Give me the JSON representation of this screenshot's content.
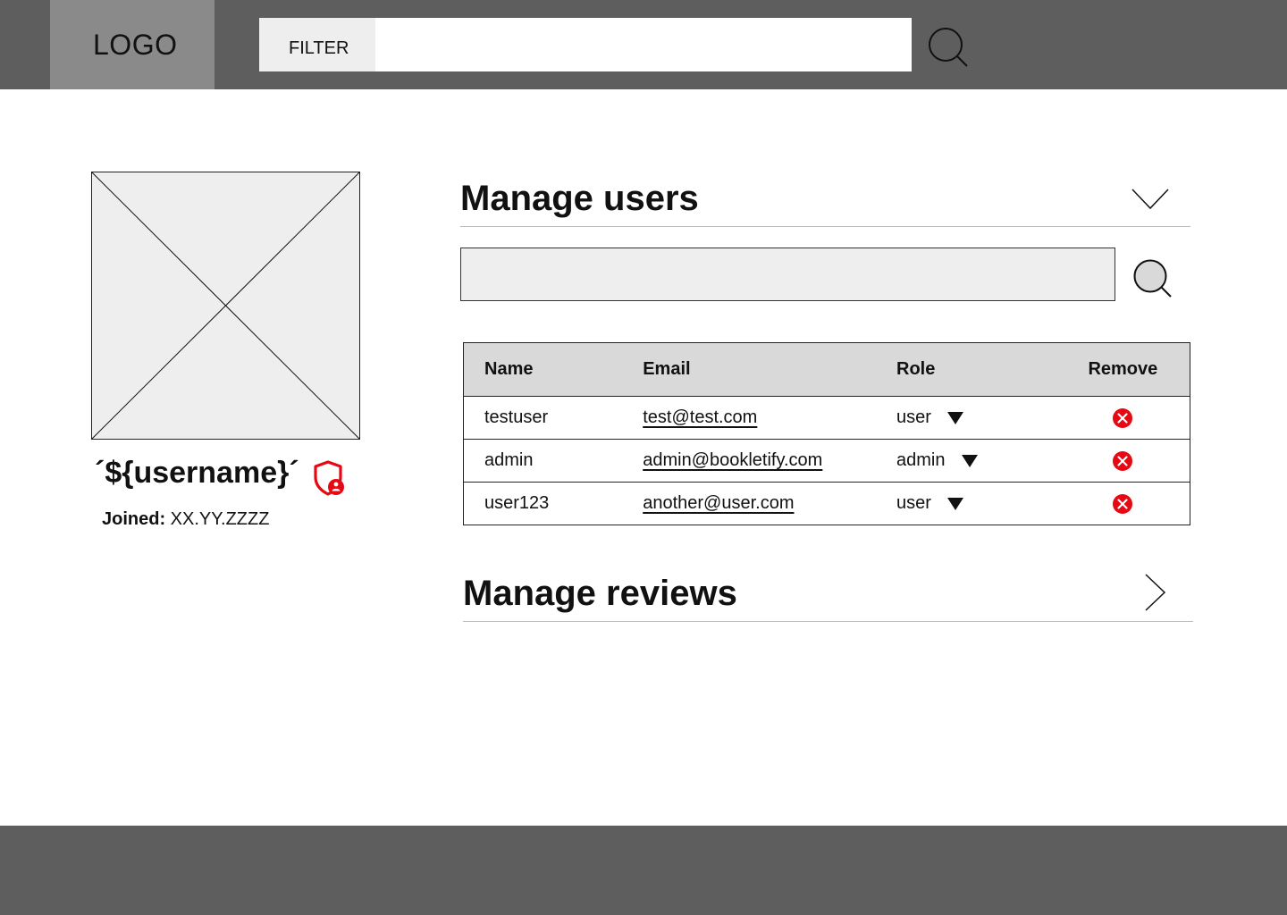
{
  "header": {
    "logo_text": "LOGO",
    "filter_label": "FILTER",
    "filter_placeholder": "",
    "search_icon": "search-icon"
  },
  "profile": {
    "avatar_icon": "image-placeholder-icon",
    "username": "´${username}´",
    "admin_icon": "admin-shield-icon",
    "joined_label": "Joined:",
    "joined_value": " XX.YY.ZZZZ"
  },
  "manage_users": {
    "title": "Manage users",
    "toggle_icon": "chevron-down-icon",
    "search_placeholder": "",
    "search_icon": "search-icon",
    "columns": [
      "Name",
      "Email",
      "Role",
      "Remove"
    ],
    "rows": [
      {
        "name": "testuser",
        "email": "test@test.com",
        "role": "user"
      },
      {
        "name": "admin",
        "email": "admin@bookletify.com",
        "role": "admin"
      },
      {
        "name": "user123",
        "email": "another@user.com",
        "role": "user"
      }
    ],
    "remove_icon": "remove-circle-icon"
  },
  "manage_reviews": {
    "title": "Manage reviews",
    "toggle_icon": "chevron-right-icon"
  },
  "colors": {
    "header_bg": "#5e5e5e",
    "logo_bg": "#8a8a8a",
    "accent_danger": "#e50914",
    "table_header_bg": "#d9d9d9",
    "placeholder_bg": "#eeeeee"
  }
}
